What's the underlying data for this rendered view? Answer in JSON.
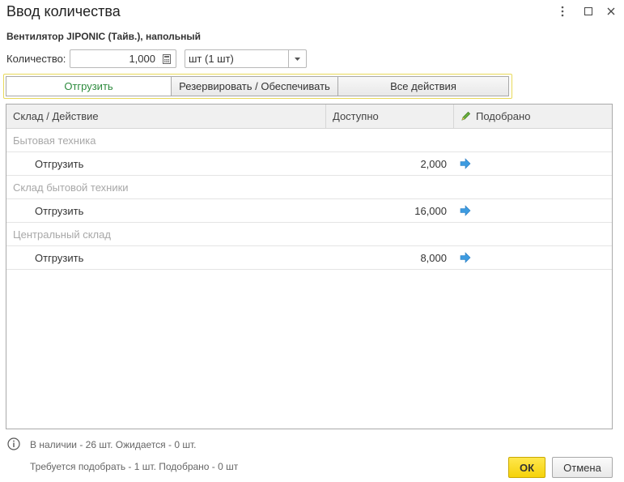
{
  "window": {
    "title": "Ввод количества",
    "product": "Вентилятор JIPONIC (Тайв.), напольный"
  },
  "quantity": {
    "label": "Количество:",
    "value": "1,000",
    "unit": "шт (1 шт)"
  },
  "actions": {
    "buttons": [
      {
        "label": "Отгрузить",
        "active": true
      },
      {
        "label": "Резервировать / Обеспечивать",
        "active": false
      },
      {
        "label": "Все действия",
        "active": false
      }
    ]
  },
  "table": {
    "columns": [
      "Склад / Действие",
      "Доступно",
      "Подобрано"
    ],
    "groups": [
      {
        "warehouse": "Бытовая техника",
        "action": "Отгрузить",
        "available": "2,000"
      },
      {
        "warehouse": "Склад бытовой техники",
        "action": "Отгрузить",
        "available": "16,000"
      },
      {
        "warehouse": "Центральный склад",
        "action": "Отгрузить",
        "available": "8,000"
      }
    ]
  },
  "footer": {
    "availability": "В наличии - 26 шт. Ожидается - 0 шт.",
    "requirement": "Требуется подобрать - 1 шт. Подобрано - 0 шт",
    "ok_label": "ОК",
    "cancel_label": "Отмена"
  },
  "colors": {
    "accent_yellow": "#f5d20a",
    "active_green": "#2e8b3e",
    "arrow_blue": "#3d9be0"
  }
}
